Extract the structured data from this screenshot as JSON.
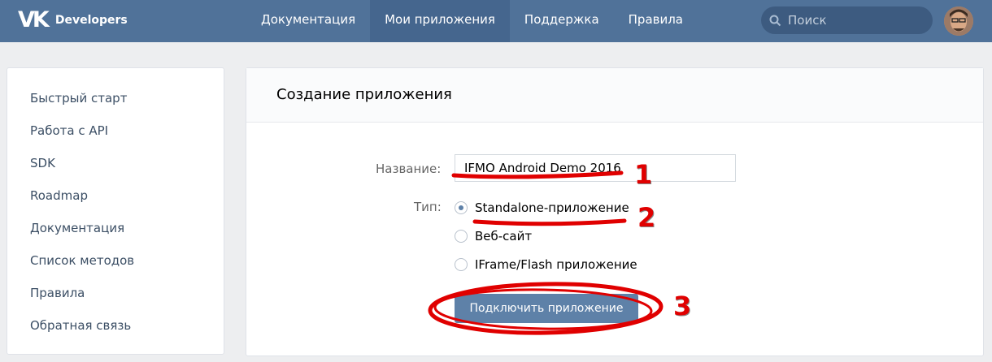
{
  "header": {
    "logo_text": "Developers",
    "nav": [
      {
        "label": "Документация"
      },
      {
        "label": "Мои приложения",
        "active": true
      },
      {
        "label": "Поддержка"
      },
      {
        "label": "Правила"
      }
    ],
    "search_placeholder": "Поиск",
    "colors": {
      "bar": "#507299",
      "active_tab": "#45668e"
    }
  },
  "sidebar": {
    "items": [
      {
        "label": "Быстрый старт"
      },
      {
        "label": "Работа с API"
      },
      {
        "label": "SDK"
      },
      {
        "label": "Roadmap"
      },
      {
        "label": "Документация"
      },
      {
        "label": "Список методов"
      },
      {
        "label": "Правила"
      },
      {
        "label": "Обратная связь"
      }
    ]
  },
  "form": {
    "title": "Создание приложения",
    "name_label": "Название:",
    "name_value": "IFMO Android Demo 2016",
    "type_label": "Тип:",
    "types": [
      {
        "label": "Standalone-приложение",
        "selected": true
      },
      {
        "label": "Веб-сайт",
        "selected": false
      },
      {
        "label": "IFrame/Flash приложение",
        "selected": false
      }
    ],
    "submit_label": "Подключить приложение"
  },
  "annotations": {
    "numbers": [
      "1",
      "2",
      "3"
    ],
    "color": "#e00000"
  }
}
